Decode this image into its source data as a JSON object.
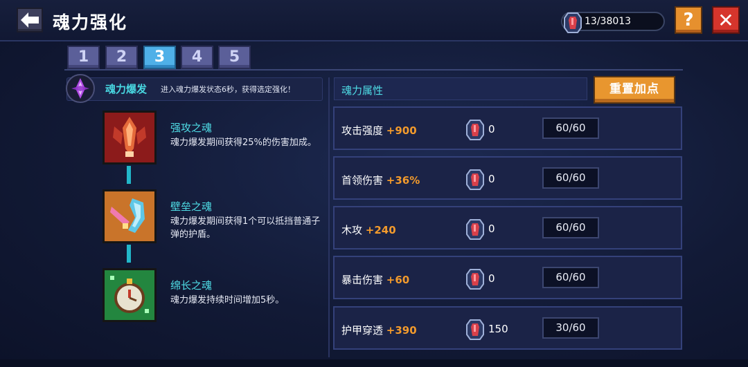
{
  "header": {
    "title": "魂力强化",
    "currency": "13/38013",
    "help_label": "?",
    "close_label": "✕"
  },
  "tabs": [
    {
      "label": "1",
      "active": false
    },
    {
      "label": "2",
      "active": false
    },
    {
      "label": "3",
      "active": true
    },
    {
      "label": "4",
      "active": false
    },
    {
      "label": "5",
      "active": false
    }
  ],
  "burst": {
    "title": "魂力爆发",
    "desc": "进入魂力爆发状态6秒，获得选定强化！"
  },
  "skills": [
    {
      "name": "强攻之魂",
      "desc": "魂力爆发期间获得25%的伤害加成。",
      "icon": "attack-soul-icon"
    },
    {
      "name": "壁垒之魂",
      "desc": "魂力爆发期间获得1个可以抵挡普通子弹的护盾。",
      "icon": "shield-soul-icon"
    },
    {
      "name": "绵长之魂",
      "desc": "魂力爆发持续时间增加5秒。",
      "icon": "clock-soul-icon"
    }
  ],
  "attributes": {
    "header": "魂力属性",
    "reset_label": "重置加点",
    "rows": [
      {
        "name": "攻击强度",
        "bonus": "+900",
        "cost": "0",
        "level": "60/60"
      },
      {
        "name": "首领伤害",
        "bonus": "+36%",
        "cost": "0",
        "level": "60/60"
      },
      {
        "name": "木攻",
        "bonus": "+240",
        "cost": "0",
        "level": "60/60"
      },
      {
        "name": "暴击伤害",
        "bonus": "+60",
        "cost": "0",
        "level": "60/60"
      },
      {
        "name": "护甲穿透",
        "bonus": "+390",
        "cost": "150",
        "level": "30/60"
      }
    ]
  },
  "colors": {
    "accent_cyan": "#4fdde6",
    "bonus_orange": "#f29a2c",
    "button_orange": "#e8962f",
    "close_red": "#d6352c",
    "tab_active": "#4fb0e8"
  }
}
